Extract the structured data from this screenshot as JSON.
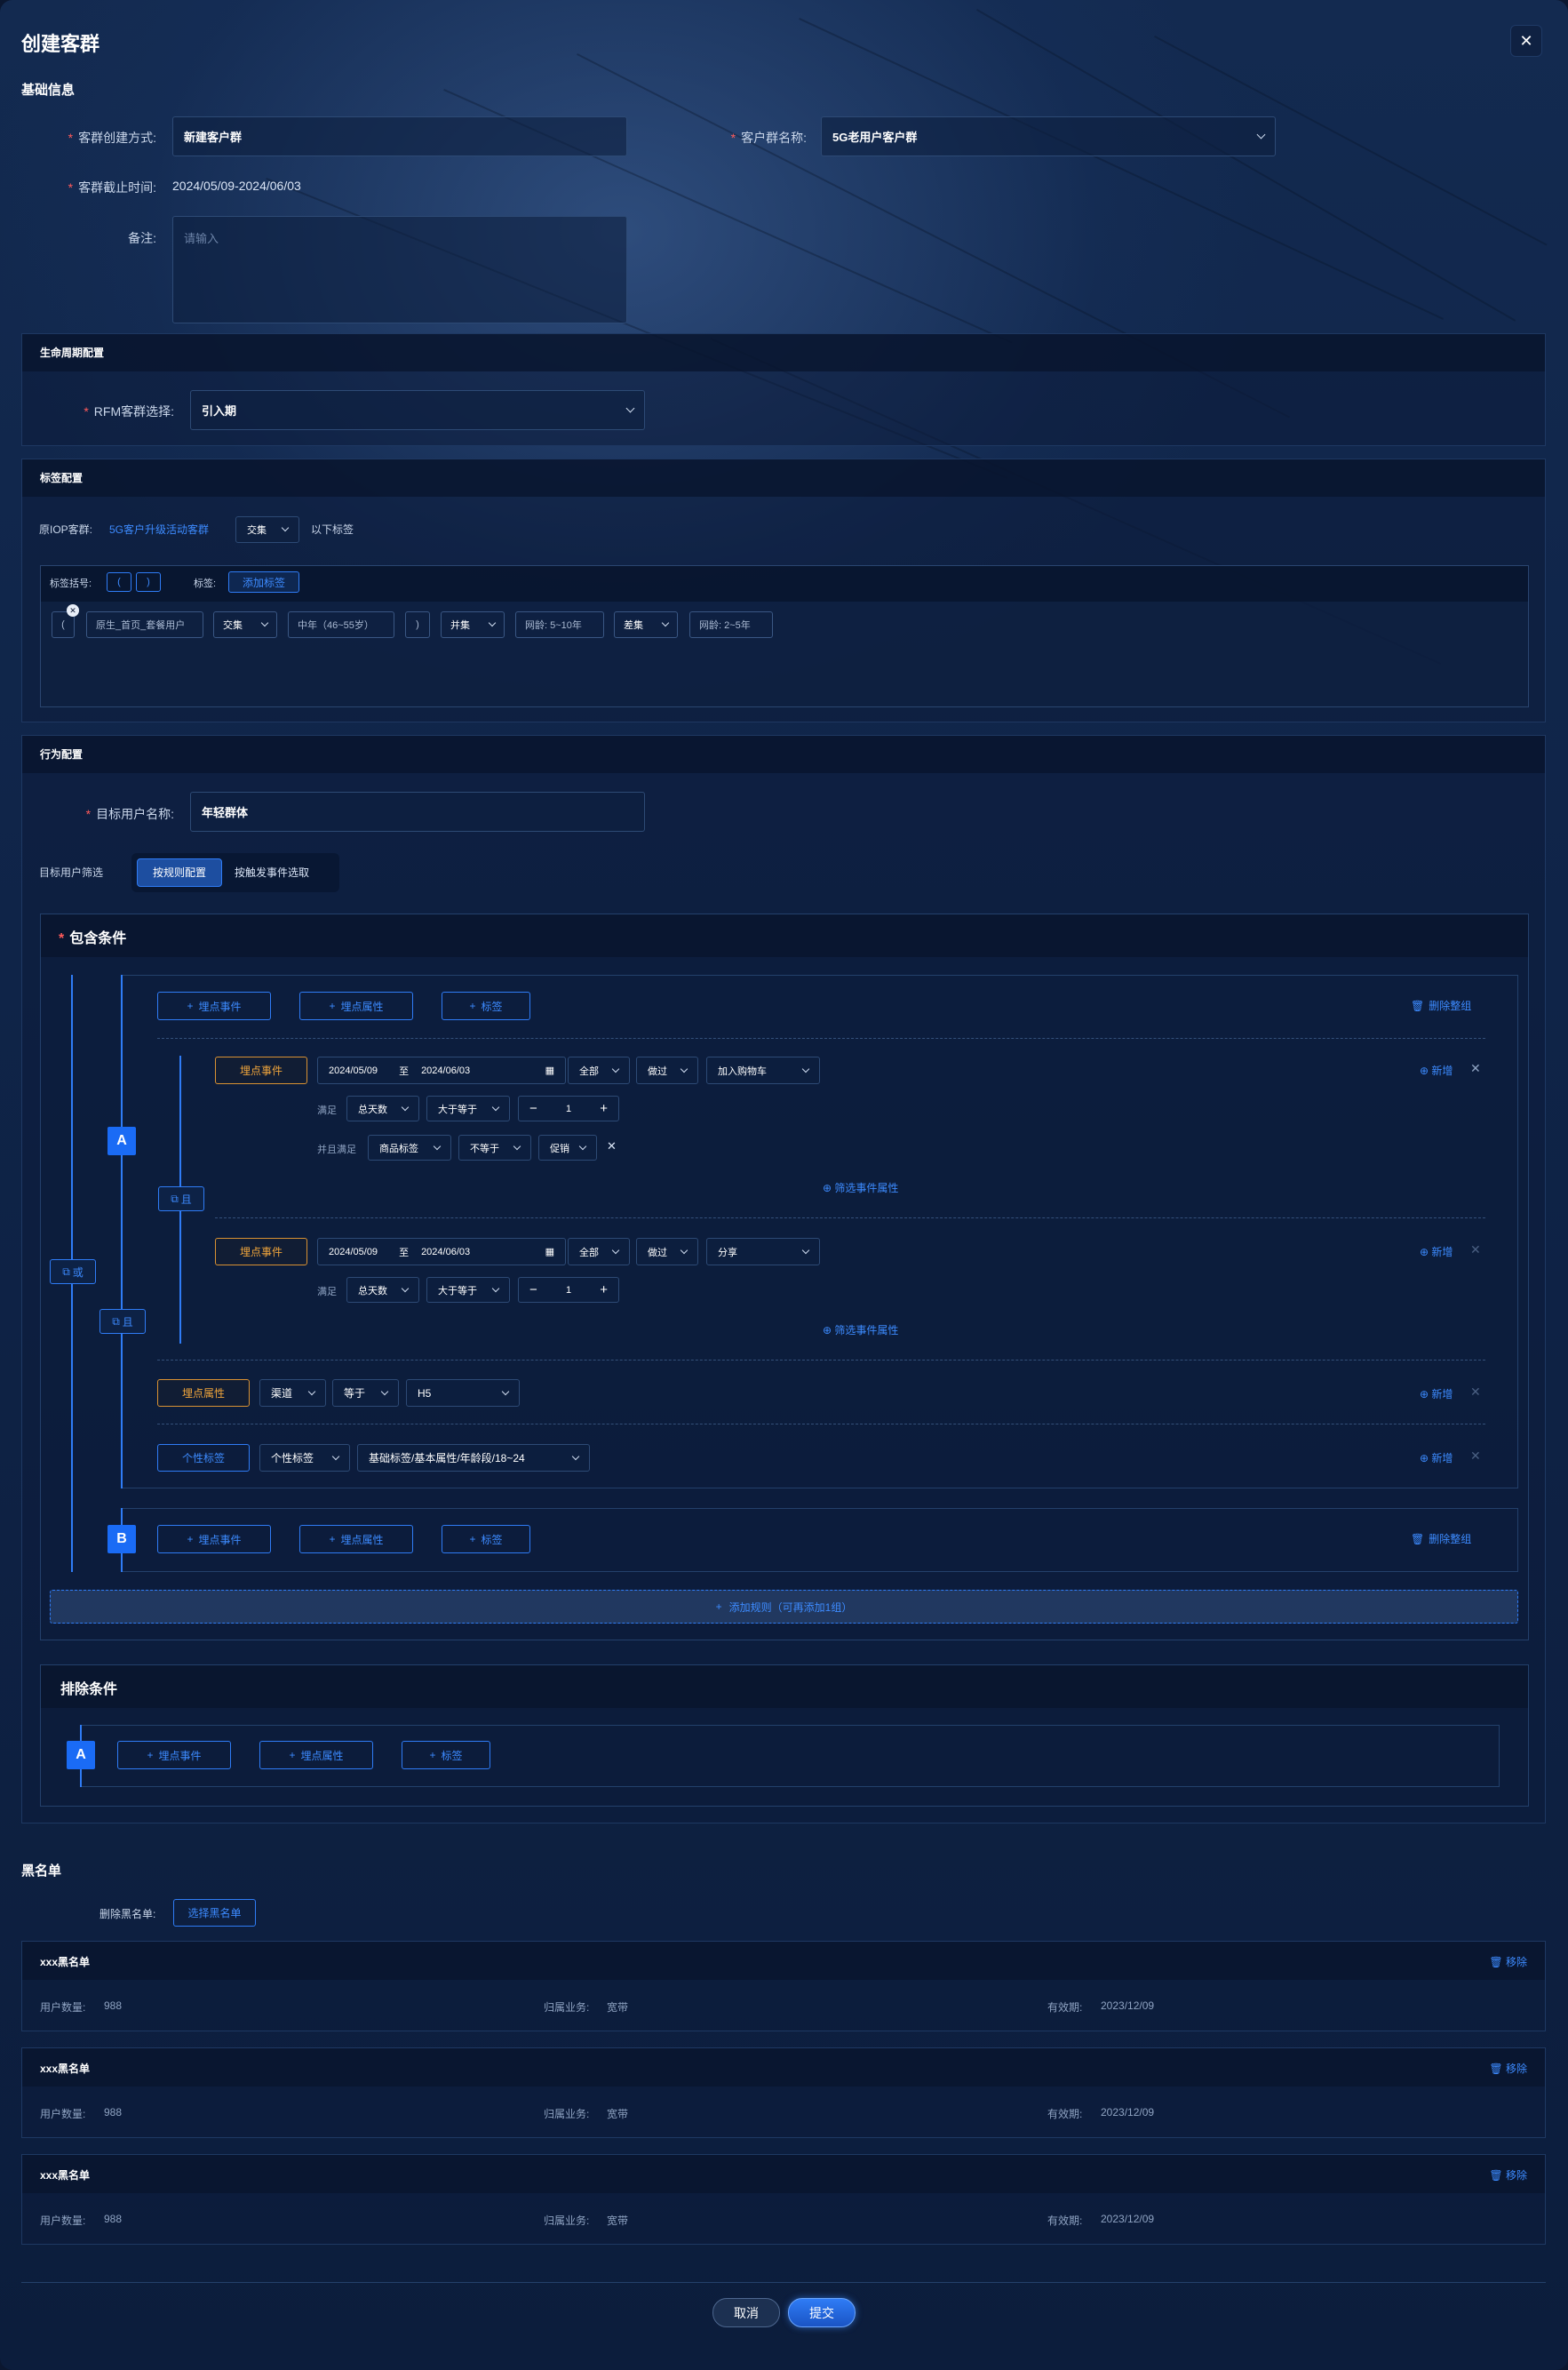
{
  "dialog": {
    "title": "创建客群"
  },
  "basic": {
    "section_title": "基础信息",
    "method_label": "客群创建方式:",
    "method_value": "新建客户群",
    "name_label": "客户群名称:",
    "name_value": "5G老用户客户群",
    "deadline_label": "客群截止时间:",
    "deadline_value": "2024/05/09-2024/06/03",
    "remark_label": "备注:",
    "remark_placeholder": "请输入"
  },
  "lifecycle": {
    "section_title": "生命周期配置",
    "rfm_label": "RFM客群选择:",
    "rfm_value": "引入期"
  },
  "tags": {
    "section_title": "标签配置",
    "origin_label": "原IOP客群:",
    "origin_link": "5G客户升级活动客群",
    "origin_op": "交集",
    "origin_suffix": "以下标签",
    "bracket_label": "标签括号:",
    "bracket_open": "(",
    "bracket_close": ")",
    "tag_label": "标签:",
    "add_tag": "添加标签",
    "expr": {
      "open": "(",
      "t1": "原生_首页_套餐用户",
      "op1": "交集",
      "t2": "中年（46~55岁）",
      "close": ")",
      "op2": "并集",
      "t3": "网龄: 5~10年",
      "op3": "差集",
      "t4": "网龄: 2~5年"
    }
  },
  "behavior": {
    "section_title": "行为配置",
    "target_label": "目标用户名称:",
    "target_value": "年轻群体",
    "filter_label": "目标用户筛选",
    "filter_opt1": "按规则配置",
    "filter_opt2": "按触发事件选取",
    "include_title": "包含条件",
    "exclude_title": "排除条件",
    "btn_event": "埋点事件",
    "btn_attr": "埋点属性",
    "btn_tag": "标签",
    "delete_group": "删除整组",
    "or_label": "或",
    "and_label": "且",
    "group_a": "A",
    "group_b": "B",
    "add_rule": "添加规则（可再添加1组）",
    "new_label": "新增",
    "filter_attr": "筛选事件属性",
    "rule1": {
      "type": "埋点事件",
      "date_from": "2024/05/09",
      "date_to_sep": "至",
      "date_to": "2024/06/03",
      "scope": "全部",
      "did": "做过",
      "event": "加入购物车",
      "meet_label": "满足",
      "metric": "总天数",
      "cmp": "大于等于",
      "qty": "1",
      "and_meet_label": "并且满足",
      "attr": "商品标签",
      "attr_cmp": "不等于",
      "attr_val": "促销"
    },
    "rule2": {
      "type": "埋点事件",
      "date_from": "2024/05/09",
      "date_to_sep": "至",
      "date_to": "2024/06/03",
      "scope": "全部",
      "did": "做过",
      "event": "分享",
      "meet_label": "满足",
      "metric": "总天数",
      "cmp": "大于等于",
      "qty": "1"
    },
    "rule3": {
      "type": "埋点属性",
      "field": "渠道",
      "cmp": "等于",
      "value": "H5"
    },
    "rule4": {
      "type": "个性标签",
      "field": "个性标签",
      "value": "基础标签/基本属性/年龄段/18~24"
    }
  },
  "blacklist": {
    "section_title": "黑名单",
    "delete_label": "删除黑名单:",
    "select_button": "选择黑名单",
    "remove": "移除",
    "count_label": "用户数量:",
    "biz_label": "归属业务:",
    "valid_label": "有效期:",
    "items": [
      {
        "name": "xxx黑名单",
        "count": "988",
        "biz": "宽带",
        "valid": "2023/12/09"
      },
      {
        "name": "xxx黑名单",
        "count": "988",
        "biz": "宽带",
        "valid": "2023/12/09"
      },
      {
        "name": "xxx黑名单",
        "count": "988",
        "biz": "宽带",
        "valid": "2023/12/09"
      }
    ]
  },
  "footer": {
    "cancel": "取消",
    "submit": "提交"
  },
  "colors": {
    "accent": "#3d8bff",
    "warning": "#f0a53c",
    "required": "#ff5a5a",
    "background": "#0f2448"
  },
  "icons": [
    "close-icon",
    "chevron-down-icon",
    "calendar-icon",
    "plus-icon",
    "minus-icon",
    "trash-icon",
    "plus-circle-icon",
    "copy-icon"
  ]
}
